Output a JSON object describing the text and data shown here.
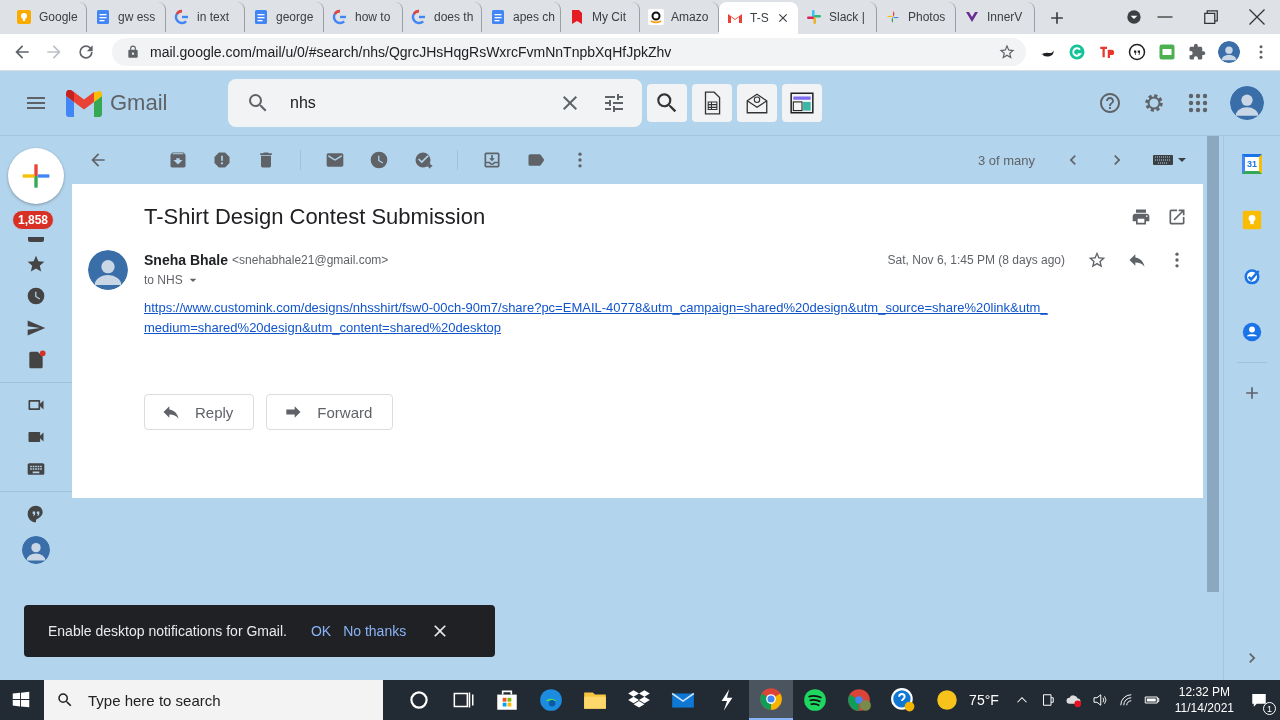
{
  "browser": {
    "tabs": [
      {
        "label": "Google",
        "kind": "keep",
        "selected": false
      },
      {
        "label": "gw ess",
        "kind": "docs",
        "selected": false
      },
      {
        "label": "in text",
        "kind": "google",
        "selected": false
      },
      {
        "label": "george",
        "kind": "docs",
        "selected": false
      },
      {
        "label": "how to",
        "kind": "google",
        "selected": false
      },
      {
        "label": "does th",
        "kind": "google",
        "selected": false
      },
      {
        "label": "apes ch",
        "kind": "docs",
        "selected": false
      },
      {
        "label": "My Cit",
        "kind": "pdf",
        "selected": false
      },
      {
        "label": "Amazo",
        "kind": "amazon",
        "selected": false
      },
      {
        "label": "T-S",
        "kind": "gmail",
        "selected": true
      },
      {
        "label": "Slack |",
        "kind": "slack",
        "selected": false
      },
      {
        "label": "Photos",
        "kind": "photos",
        "selected": false
      },
      {
        "label": "InnerV",
        "kind": "innerv",
        "selected": false
      }
    ],
    "url": "mail.google.com/mail/u/0/#search/nhs/QgrcJHsHqgRsWxrcFvmNnTnpbXqHfJpkZhv"
  },
  "header": {
    "app_name": "Gmail",
    "search": {
      "value": "nhs"
    }
  },
  "left_rail": {
    "unread_badge": "1,858"
  },
  "toolbar": {
    "pager": "3 of many"
  },
  "message": {
    "subject": "T-Shirt Design Contest Submission",
    "sender_name": "Sneha Bhale",
    "sender_email": "<snehabhale21@gmail.com>",
    "recipient": "to NHS",
    "date": "Sat, Nov 6, 1:45 PM (8 days ago)",
    "link_lines": [
      "https://www.customink.com/designs/nhsshirt/fsw0-00ch-90m7/share?pc=EMAIL-40778&utm_campaign=shared%20design&utm_source=share%20link&utm_",
      "medium=shared%20design&utm_content=shared%20desktop"
    ],
    "buttons": [
      {
        "label": "Reply",
        "kind": "reply"
      },
      {
        "label": "Forward",
        "kind": "forward"
      }
    ]
  },
  "right_panel": {
    "calendar_day": "31"
  },
  "snackbar": {
    "text": "Enable desktop notifications for Gmail.",
    "ok": "OK",
    "dismiss": "No thanks"
  },
  "taskbar": {
    "search_placeholder": "Type here to search",
    "weather": "75°F",
    "time": "12:32 PM",
    "date": "11/14/2021",
    "notification_count": "1"
  }
}
